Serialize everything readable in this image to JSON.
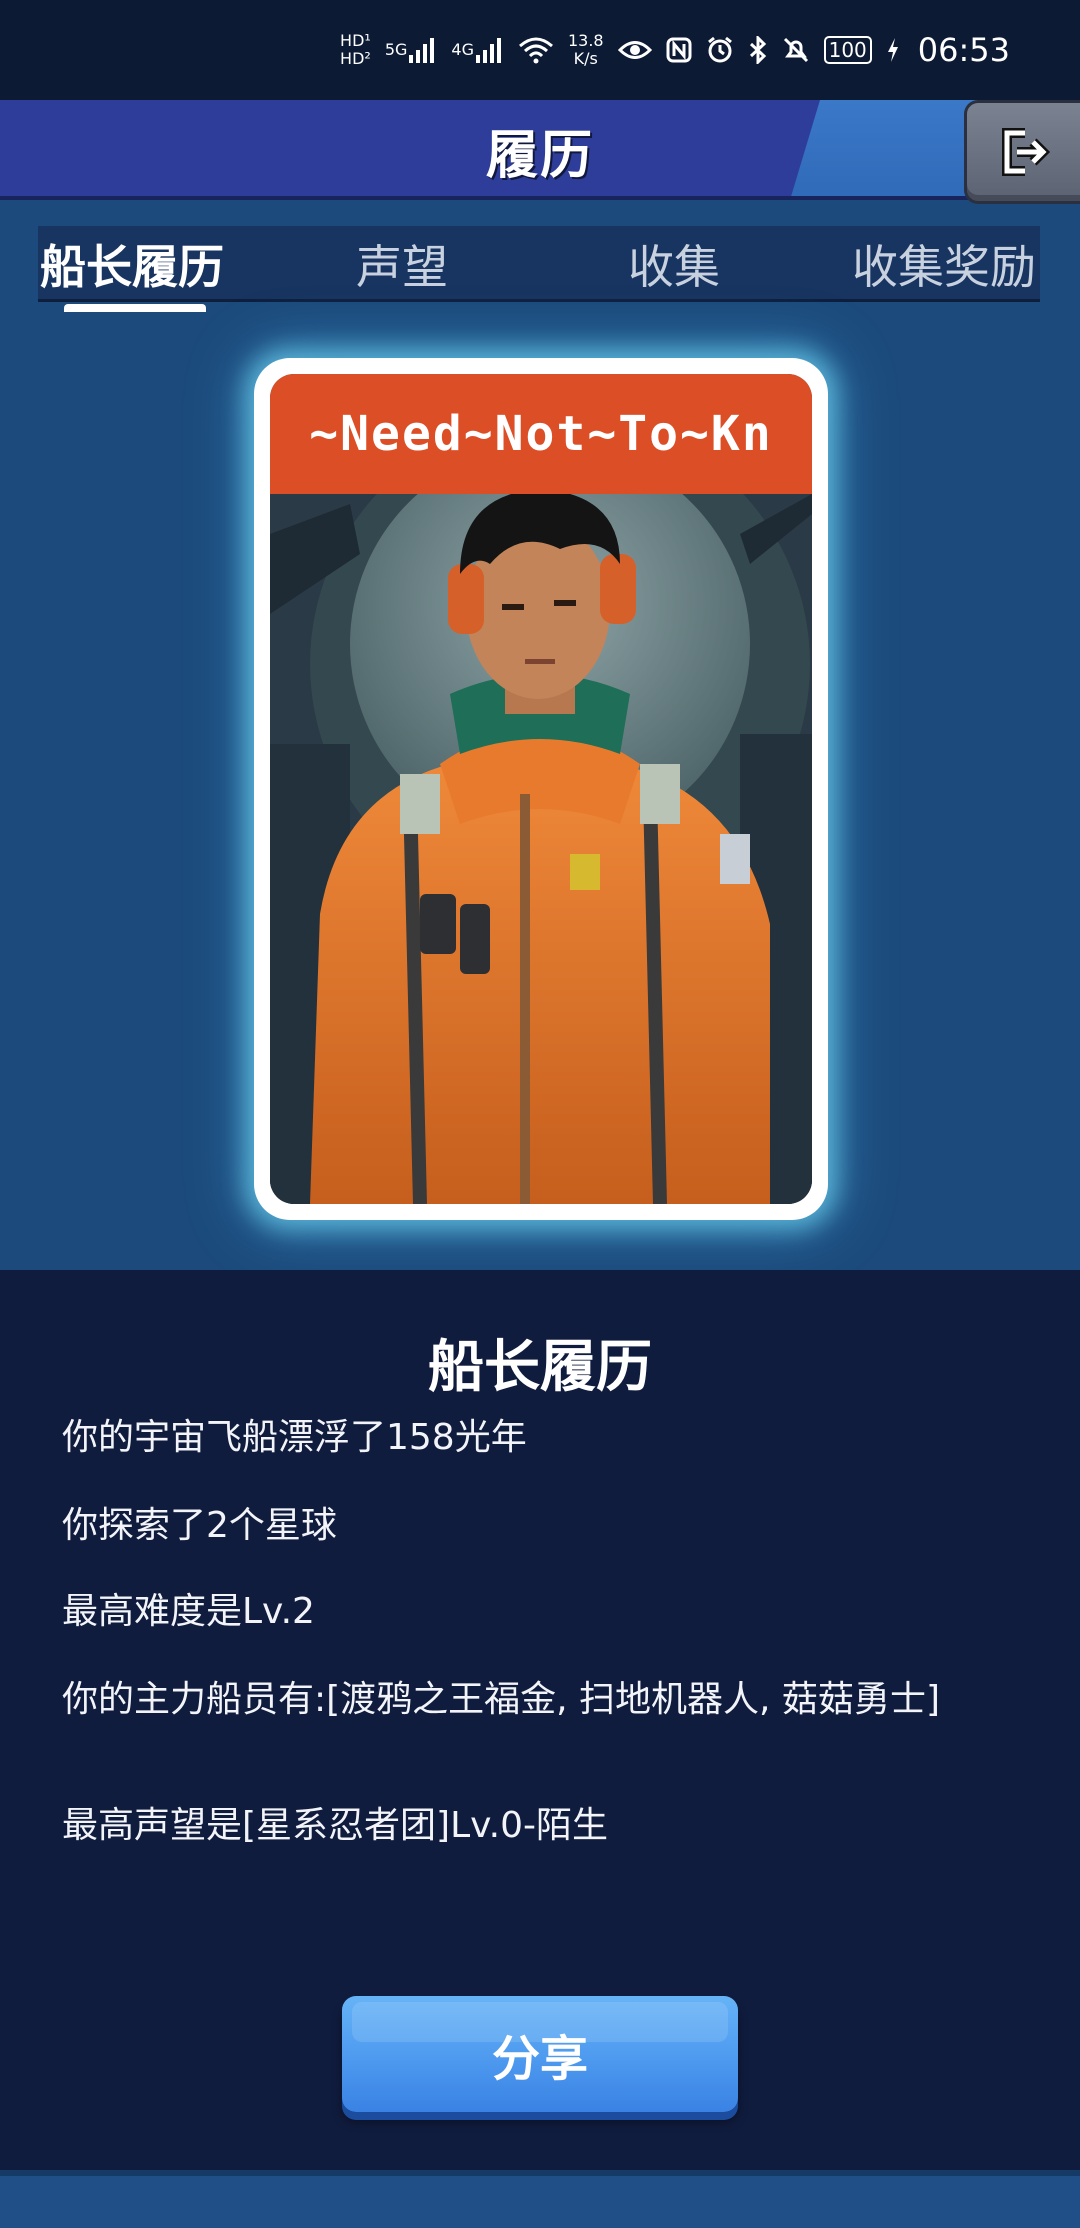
{
  "status_bar": {
    "hd1": "HD",
    "hd2": "HD",
    "net1": "5G",
    "net2": "4G",
    "speed_value": "13.8",
    "speed_unit": "K/s",
    "battery": "100",
    "time": "06:53"
  },
  "header": {
    "title": "履历"
  },
  "tabs": [
    {
      "label": "船长履历",
      "active": true
    },
    {
      "label": "声望",
      "active": false
    },
    {
      "label": "收集",
      "active": false
    },
    {
      "label": "收集奖励",
      "active": false
    }
  ],
  "card": {
    "banner_text": "~Need~Not~To~Kn"
  },
  "info": {
    "heading": "船长履历",
    "lines": [
      "你的宇宙飞船漂浮了158光年",
      "你探索了2个星球",
      "最高难度是Lv.2",
      "你的主力船员有:[渡鸦之王福金, 扫地机器人, 菇菇勇士]",
      "最高声望是[星系忍者团]Lv.0-陌生"
    ]
  },
  "share_button": {
    "label": "分享"
  },
  "colors": {
    "background": "#1c4a7c",
    "title_bar": "#2e3d9a",
    "banner": "#dc4f26",
    "info_panel": "#101c3e",
    "share_button": "#4f9cf0"
  }
}
